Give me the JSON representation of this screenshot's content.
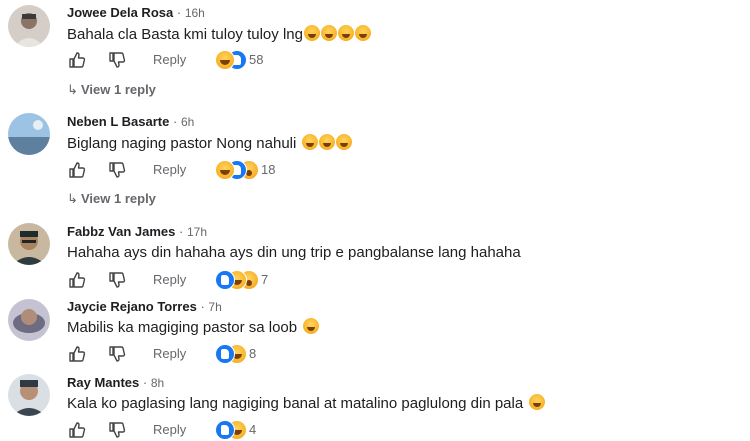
{
  "comments": [
    {
      "name": "Jowee Dela Rosa",
      "time": "16h",
      "text": "Bahala cla Basta kmi tuloy tuloy lng",
      "emoji_count": 4,
      "reply_label": "Reply",
      "reactions": [
        "haha",
        "like"
      ],
      "reaction_count": "58",
      "view_replies": "View 1 reply",
      "avatar_colors": [
        "#c9c2bd",
        "#3d3a3a"
      ]
    },
    {
      "name": "Neben L Basarte",
      "time": "6h",
      "text": "Biglang naging pastor Nong nahuli",
      "emoji_count": 3,
      "reply_label": "Reply",
      "reactions": [
        "haha",
        "like",
        "wow"
      ],
      "reaction_count": "18",
      "view_replies": "View 1 reply",
      "avatar_colors": [
        "#8fb8d9",
        "#4c6f93"
      ]
    },
    {
      "name": "Fabbz Van James",
      "time": "17h",
      "text": "Hahaha ays din hahaha ays din ung trip e pangbalanse lang hahaha",
      "emoji_count": 0,
      "reply_label": "Reply",
      "reactions": [
        "like",
        "haha",
        "wow"
      ],
      "reaction_count": "7",
      "avatar_colors": [
        "#bfae98",
        "#1e2a2b"
      ]
    },
    {
      "name": "Jaycie Rejano Torres",
      "time": "7h",
      "text": "Mabilis ka magiging pastor sa loob",
      "emoji_count": 1,
      "reply_label": "Reply",
      "reactions": [
        "like",
        "haha"
      ],
      "reaction_count": "8",
      "avatar_colors": [
        "#b4b4c8",
        "#5c5c70"
      ]
    },
    {
      "name": "Ray Mantes",
      "time": "8h",
      "text": "Kala ko paglasing lang nagiging banal at matalino paglulong din pala",
      "emoji_count": 1,
      "reply_label": "Reply",
      "reactions": [
        "like",
        "haha"
      ],
      "reaction_count": "4",
      "avatar_colors": [
        "#cfd6db",
        "#2f3a44"
      ]
    }
  ],
  "icons": {
    "like": "thumbs-up-icon",
    "dislike": "thumbs-down-icon",
    "reply_arrow": "reply-arrow-icon",
    "emoji": "laughing-emoji-icon"
  }
}
